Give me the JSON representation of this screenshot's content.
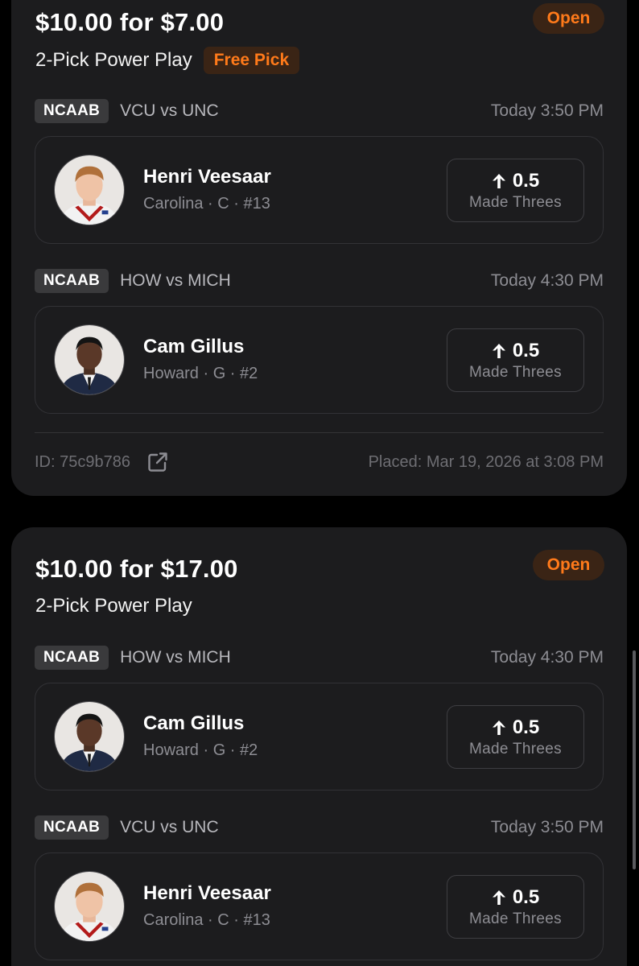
{
  "colors": {
    "accent_orange": "#ff7a1a",
    "badge_bg": "#3a2415",
    "card_bg": "#1c1c1e",
    "page_bg": "#000000"
  },
  "bets": [
    {
      "amount": "$10.00 for $7.00",
      "status": "Open",
      "play_type": "2-Pick Power Play",
      "promo": "Free Pick",
      "picks": [
        {
          "league": "NCAAB",
          "matchup": "VCU vs UNC",
          "time": "Today 3:50 PM",
          "player": "Henri Veesaar",
          "meta": "Carolina · C · #13",
          "direction_icon": "arrow-up-icon",
          "line": "0.5",
          "stat": "Made Threes",
          "avatar": "player-headshot-henri-veesaar"
        },
        {
          "league": "NCAAB",
          "matchup": "HOW vs MICH",
          "time": "Today 4:30 PM",
          "player": "Cam Gillus",
          "meta": "Howard · G · #2",
          "direction_icon": "arrow-up-icon",
          "line": "0.5",
          "stat": "Made Threes",
          "avatar": "player-headshot-cam-gillus"
        }
      ],
      "id_label": "ID: 75c9b786",
      "link_icon": "external-link-icon",
      "placed": "Placed: Mar 19, 2026 at 3:08 PM"
    },
    {
      "amount": "$10.00 for $17.00",
      "status": "Open",
      "play_type": "2-Pick Power Play",
      "picks": [
        {
          "league": "NCAAB",
          "matchup": "HOW vs MICH",
          "time": "Today 4:30 PM",
          "player": "Cam Gillus",
          "meta": "Howard · G · #2",
          "direction_icon": "arrow-up-icon",
          "line": "0.5",
          "stat": "Made Threes",
          "avatar": "player-headshot-cam-gillus"
        },
        {
          "league": "NCAAB",
          "matchup": "VCU vs UNC",
          "time": "Today 3:50 PM",
          "player": "Henri Veesaar",
          "meta": "Carolina · C · #13",
          "direction_icon": "arrow-up-icon",
          "line": "0.5",
          "stat": "Made Threes",
          "avatar": "player-headshot-henri-veesaar"
        }
      ]
    }
  ]
}
